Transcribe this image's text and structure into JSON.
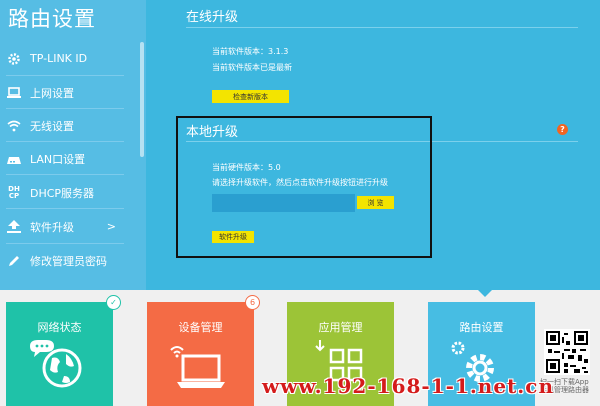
{
  "sidebar": {
    "title": "路由设置",
    "items": [
      {
        "label": "TP-LINK ID",
        "icon": "gear-icon"
      },
      {
        "label": "上网设置",
        "icon": "laptop-icon"
      },
      {
        "label": "无线设置",
        "icon": "wifi-icon"
      },
      {
        "label": "LAN口设置",
        "icon": "router-icon"
      },
      {
        "label": "DHCP服务器",
        "icon": "dhcp-icon"
      },
      {
        "label": "软件升级",
        "icon": "upload-icon",
        "chevron": ">"
      },
      {
        "label": "修改管理员密码",
        "icon": "pencil-icon"
      }
    ]
  },
  "online_upgrade": {
    "title": "在线升级",
    "current_version_text": "当前软件版本：3.1.3",
    "status_text": "当前软件版本已是最新",
    "check_button": "检查新版本"
  },
  "local_upgrade": {
    "title": "本地升级",
    "help_icon": "?",
    "hardware_version_text": "当前硬件版本：5.0",
    "instruction_text": "请选择升级软件，然后点击软件升级按钮进行升级",
    "file_value": "",
    "browse_button": "浏 览",
    "upgrade_button": "软件升级"
  },
  "tiles": [
    {
      "label": "网络状态",
      "color": "#1fc2a8",
      "badge": "✓",
      "icon": "globe-icon"
    },
    {
      "label": "设备管理",
      "color": "#f46b45",
      "badge": "6",
      "icon": "laptop-wifi-icon"
    },
    {
      "label": "应用管理",
      "color": "#9cc437",
      "icon": "apps-grid-icon"
    },
    {
      "label": "路由设置",
      "color": "#47bde3",
      "icon": "settings-gears-icon"
    }
  ],
  "qr_caption": "扫一扫下载App\n手机管理路由器",
  "watermark": "www.192-168-1-1.net.cn"
}
